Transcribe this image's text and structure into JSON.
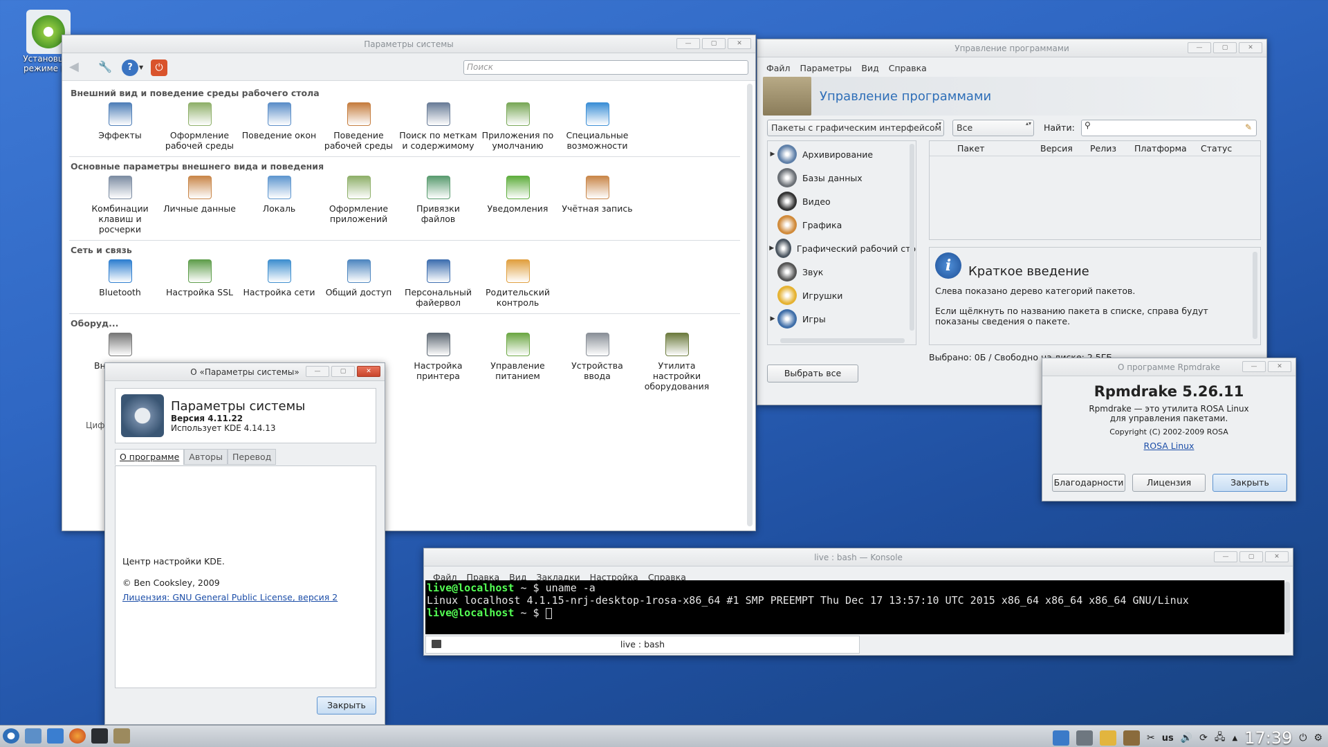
{
  "desktop": {
    "icon_label_1": "Установщ...",
    "icon_label_2": "режиме L..."
  },
  "syssettings": {
    "title": "Параметры системы",
    "search_placeholder": "Поиск",
    "categories": [
      {
        "title": "Внешний вид и поведение среды рабочего стола",
        "items": [
          {
            "label": "Эффекты",
            "color": "#4f7fb8"
          },
          {
            "label": "Оформление рабочей среды",
            "color": "#8fb06a"
          },
          {
            "label": "Поведение окон",
            "color": "#5b8ec8"
          },
          {
            "label": "Поведение рабочей среды",
            "color": "#c57d3f"
          },
          {
            "label": "Поиск по меткам и содержимому",
            "color": "#6a7d98"
          },
          {
            "label": "Приложения по умолчанию",
            "color": "#79a858"
          },
          {
            "label": "Специальные возможности",
            "color": "#3c8fd6"
          }
        ]
      },
      {
        "title": "Основные параметры внешнего вида и поведения",
        "items": [
          {
            "label": "Комбинации клавиш и росчерки",
            "color": "#7d8da3"
          },
          {
            "label": "Личные данные",
            "color": "#c9874a"
          },
          {
            "label": "Локаль",
            "color": "#5f97cf"
          },
          {
            "label": "Оформление приложений",
            "color": "#8fb06a"
          },
          {
            "label": "Привязки файлов",
            "color": "#5a9c70"
          },
          {
            "label": "Уведомления",
            "color": "#5fae3e"
          },
          {
            "label": "Учётная запись",
            "color": "#c9874a"
          }
        ]
      },
      {
        "title": "Сеть и связь",
        "items": [
          {
            "label": "Bluetooth",
            "color": "#2f7fd0"
          },
          {
            "label": "Настройка SSL",
            "color": "#5f9e4c"
          },
          {
            "label": "Настройка сети",
            "color": "#3f8fcf"
          },
          {
            "label": "Общий доступ",
            "color": "#4f87c0"
          },
          {
            "label": "Персональный файервол",
            "color": "#3f6fb0"
          },
          {
            "label": "Родительский контроль",
            "color": "#e0a040"
          }
        ]
      },
      {
        "title": "Оборуд...",
        "items": [
          {
            "label": "Вне... нос...",
            "color": "#777"
          },
          {
            "label": "",
            "color": ""
          },
          {
            "label": "",
            "color": ""
          },
          {
            "label": "",
            "color": ""
          },
          {
            "label": "Настройка принтера",
            "color": "#5f6a75"
          },
          {
            "label": "Управление питанием",
            "color": "#6da845"
          },
          {
            "label": "Устройства ввода",
            "color": "#8a9098"
          },
          {
            "label": "Утилита настройки оборудования",
            "color": "#6d7c3f"
          }
        ]
      }
    ],
    "partial_bottom": "Циф..."
  },
  "about": {
    "title": "О «Параметры системы»",
    "app_name": "Параметры системы",
    "version": "Версия 4.11.22",
    "uses": "Использует KDE 4.14.13",
    "tabs": [
      "О программе",
      "Авторы",
      "Перевод"
    ],
    "desc": "Центр настройки KDE.",
    "copyright": "© Ben Cooksley, 2009",
    "license": "Лицензия: GNU General Public License, версия 2",
    "close": "Закрыть"
  },
  "rpmdrake": {
    "title": "Управление программами",
    "menu": [
      "Файл",
      "Параметры",
      "Вид",
      "Справка"
    ],
    "header": "Управление программами",
    "filter1": "Пакеты с графическим интерфейсом",
    "filter2": "Все",
    "find_label": "Найти:",
    "tree": [
      {
        "label": "Архивирование",
        "expand": "▶",
        "color": "#5e7fa8"
      },
      {
        "label": "Базы данных",
        "expand": "",
        "color": "#6a6f75"
      },
      {
        "label": "Видео",
        "expand": "",
        "color": "#333"
      },
      {
        "label": "Графика",
        "expand": "",
        "color": "#d08a3a"
      },
      {
        "label": "Графический рабочий сто",
        "expand": "▶",
        "color": "#4a5560"
      },
      {
        "label": "Звук",
        "expand": "",
        "color": "#555"
      },
      {
        "label": "Игрушки",
        "expand": "",
        "color": "#e5b232"
      },
      {
        "label": "Игры",
        "expand": "▶",
        "color": "#3f6ea8"
      }
    ],
    "columns": [
      "Пакет",
      "Версия",
      "Релиз",
      "Платформа",
      "Статус"
    ],
    "info_title": "Краткое введение",
    "info_p1": "Слева показано дерево категорий пакетов.",
    "info_p2": "Если щёлкнуть по названию пакета в списке, справа будут показаны сведения о пакете.",
    "status": "Выбрано: 0Б / Свободно на диске: 2,5ГБ",
    "select_all": "Выбрать все"
  },
  "aboutrpm": {
    "title": "О программе Rpmdrake",
    "name": "Rpmdrake 5.26.11",
    "desc1": "Rpmdrake — это утилита ROSA Linux",
    "desc2": "для управления пакетами.",
    "copyright": "Copyright (C) 2002-2009 ROSA",
    "link": "ROSA Linux",
    "btn1": "Благодарности",
    "btn2": "Лицензия",
    "btn3": "Закрыть"
  },
  "konsole": {
    "title": "live : bash — Konsole",
    "menu": [
      "Файл",
      "Правка",
      "Вид",
      "Закладки",
      "Настройка",
      "Справка"
    ],
    "prompt1": "live@localhost",
    "path1": " ~ $ ",
    "cmd1": "uname -a",
    "output": "Linux localhost 4.1.15-nrj-desktop-1rosa-x86_64 #1 SMP PREEMPT Thu Dec 17 13:57:10 UTC 2015 x86_64 x86_64 x86_64 GNU/Linux",
    "prompt2": "live@localhost",
    "path2": " ~ $ ",
    "tab": "live : bash"
  },
  "taskbar": {
    "layout": "us",
    "clock": "17:39"
  },
  "colors": {
    "accent": "#3a74c2",
    "header_blue": "#2f6fb8"
  }
}
